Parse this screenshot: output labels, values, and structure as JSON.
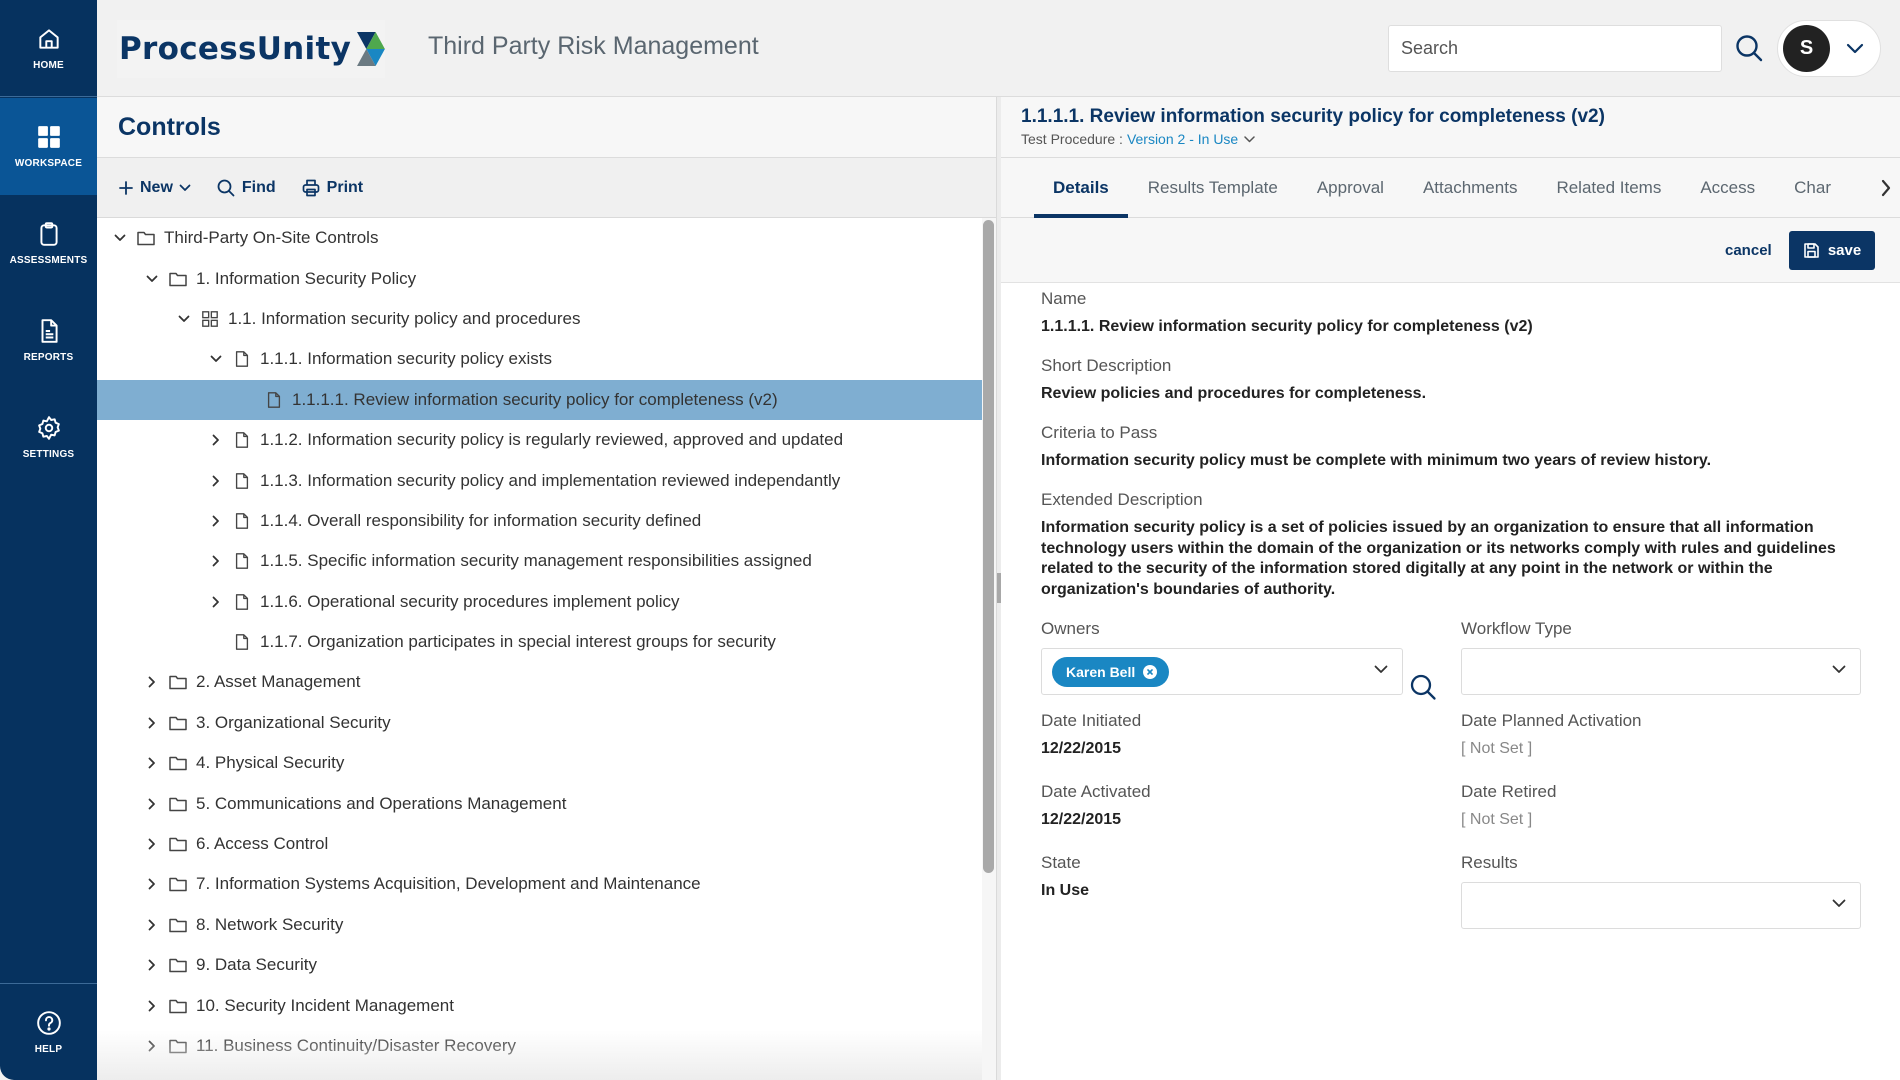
{
  "sidebar": {
    "items": [
      {
        "label": "HOME",
        "icon": "home-icon"
      },
      {
        "label": "WORKSPACE",
        "icon": "grid-icon",
        "active": true
      },
      {
        "label": "ASSESSMENTS",
        "icon": "clipboard-icon"
      },
      {
        "label": "REPORTS",
        "icon": "document-icon"
      },
      {
        "label": "SETTINGS",
        "icon": "gear-icon"
      },
      {
        "label": "HELP",
        "icon": "help-icon"
      }
    ]
  },
  "header": {
    "logo_text": "ProcessUnity",
    "app_title": "Third Party Risk Management",
    "search_placeholder": "Search",
    "user_initial": "S"
  },
  "left": {
    "title": "Controls",
    "toolbar": {
      "new_label": "New",
      "find_label": "Find",
      "print_label": "Print"
    },
    "tree": [
      {
        "label": "Third-Party On-Site Controls",
        "level": 0,
        "icon": "folder",
        "twisty": "expanded"
      },
      {
        "label": "1. Information Security Policy",
        "level": 1,
        "icon": "folder",
        "twisty": "expanded"
      },
      {
        "label": "1.1. Information security policy and procedures",
        "level": 2,
        "icon": "grid",
        "twisty": "expanded"
      },
      {
        "label": "1.1.1. Information security policy exists",
        "level": 3,
        "icon": "file",
        "twisty": "expanded"
      },
      {
        "label": "1.1.1.1. Review information security policy for completeness (v2)",
        "level": 4,
        "icon": "file",
        "twisty": "none",
        "selected": true
      },
      {
        "label": "1.1.2. Information security policy is regularly reviewed, approved and updated",
        "level": 3,
        "icon": "file",
        "twisty": "collapsed"
      },
      {
        "label": "1.1.3. Information security policy and implementation reviewed independantly",
        "level": 3,
        "icon": "file",
        "twisty": "collapsed"
      },
      {
        "label": "1.1.4. Overall responsibility for information security defined",
        "level": 3,
        "icon": "file",
        "twisty": "collapsed"
      },
      {
        "label": "1.1.5. Specific information security management responsibilities assigned",
        "level": 3,
        "icon": "file",
        "twisty": "collapsed"
      },
      {
        "label": "1.1.6. Operational security procedures implement policy",
        "level": 3,
        "icon": "file",
        "twisty": "collapsed"
      },
      {
        "label": "1.1.7. Organization participates in special interest groups for security",
        "level": 3,
        "icon": "file",
        "twisty": "none"
      },
      {
        "label": "2. Asset Management",
        "level": 1,
        "icon": "folder",
        "twisty": "collapsed"
      },
      {
        "label": "3. Organizational Security",
        "level": 1,
        "icon": "folder",
        "twisty": "collapsed"
      },
      {
        "label": "4. Physical Security",
        "level": 1,
        "icon": "folder",
        "twisty": "collapsed"
      },
      {
        "label": "5. Communications and Operations Management",
        "level": 1,
        "icon": "folder",
        "twisty": "collapsed"
      },
      {
        "label": "6. Access Control",
        "level": 1,
        "icon": "folder",
        "twisty": "collapsed"
      },
      {
        "label": "7. Information Systems Acquisition, Development and Maintenance",
        "level": 1,
        "icon": "folder",
        "twisty": "collapsed"
      },
      {
        "label": "8. Network Security",
        "level": 1,
        "icon": "folder",
        "twisty": "collapsed"
      },
      {
        "label": "9. Data Security",
        "level": 1,
        "icon": "folder",
        "twisty": "collapsed"
      },
      {
        "label": "10. Security Incident Management",
        "level": 1,
        "icon": "folder",
        "twisty": "collapsed"
      },
      {
        "label": "11. Business Continuity/Disaster Recovery",
        "level": 1,
        "icon": "folder",
        "twisty": "collapsed"
      }
    ]
  },
  "detail": {
    "title": "1.1.1.1. Review information security policy for completeness (v2)",
    "subtitle_label": "Test Procedure :",
    "version": "Version 2 - In Use",
    "tabs": [
      "Details",
      "Results Template",
      "Approval",
      "Attachments",
      "Related Items",
      "Access",
      "Char"
    ],
    "active_tab": "Details",
    "cancel_label": "cancel",
    "save_label": "save",
    "fields": {
      "name": {
        "label": "Name",
        "value": "1.1.1.1. Review information security policy for completeness (v2)"
      },
      "short_description": {
        "label": "Short Description",
        "value": "Review policies and procedures for completeness."
      },
      "criteria": {
        "label": "Criteria to Pass",
        "value": "Information security policy must be complete with minimum two years of review history."
      },
      "extended_description": {
        "label": "Extended Description",
        "value": "Information security policy is a set of policies issued by an organization to ensure that all information technology users within the domain of the organization or its networks comply with rules and guidelines related to the security of the information stored digitally at any point in the network or within the organization's boundaries of authority."
      },
      "owners": {
        "label": "Owners",
        "chips": [
          "Karen Bell"
        ]
      },
      "workflow_type": {
        "label": "Workflow Type",
        "value": ""
      },
      "date_initiated": {
        "label": "Date Initiated",
        "value": "12/22/2015"
      },
      "date_planned_activation": {
        "label": "Date Planned Activation",
        "value": "[ Not Set ]"
      },
      "date_activated": {
        "label": "Date Activated",
        "value": "12/22/2015"
      },
      "date_retired": {
        "label": "Date Retired",
        "value": "[ Not Set ]"
      },
      "state": {
        "label": "State",
        "value": "In Use"
      },
      "results": {
        "label": "Results",
        "value": ""
      }
    }
  },
  "colors": {
    "sidebar_bg": "#06325f",
    "sidebar_active": "#0a5596",
    "brand_navy": "#0b3565",
    "accent_blue": "#1a87c3",
    "selected_row": "#7faed1"
  }
}
